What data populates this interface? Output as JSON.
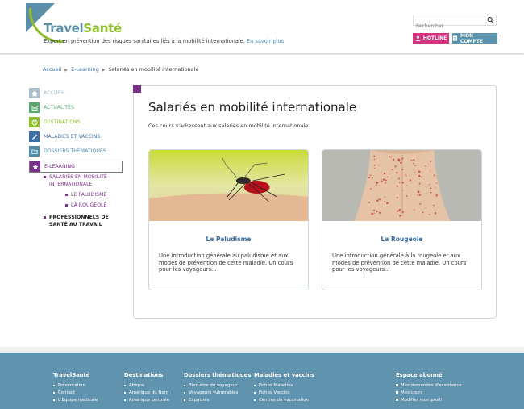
{
  "colors": {
    "brand_blue": "#5b8fa8",
    "brand_green": "#8fbf2c",
    "hotline": "#d3337f",
    "account": "#5a93ad",
    "purple": "#7a2f8a",
    "footer_bg": "#5f93ae"
  },
  "header": {
    "brand_part1": "Travel",
    "brand_part2": "Santé",
    "tagline": "Expert en prévention des risques sanitaires liés à la mobilité internationale.",
    "tagline_link": "En savoir plus",
    "search_placeholder": "Rechercher",
    "hotline_label": "HOTLINE",
    "account_label": "MON COMPTE"
  },
  "breadcrumb": {
    "home": "Accueil",
    "section": "E-Learning",
    "current": "Salariés en mobilité internationale"
  },
  "sidebar": {
    "items": [
      {
        "label": "Accueil",
        "icon": "home-icon",
        "color": "#a9bfcc"
      },
      {
        "label": "Actualités",
        "icon": "news-icon",
        "color": "#5aa870"
      },
      {
        "label": "Destinations",
        "icon": "globe-icon",
        "color": "#8fbf2c"
      },
      {
        "label": "Maladies et vaccins",
        "icon": "syringe-icon",
        "color": "#3b6ea5"
      },
      {
        "label": "Dossiers thématiques",
        "icon": "folder-icon",
        "color": "#4f8aa8"
      },
      {
        "label": "E-Learning",
        "icon": "graduation-cap-icon",
        "color": "#7a2f8a"
      }
    ],
    "sub": {
      "group1": "Salariés en mobilité internationale",
      "child1": "Le paludisme",
      "child2": "La rougeole",
      "group2": "Professionnels de santé au travail"
    }
  },
  "content": {
    "title": "Salariés en mobilité internationale",
    "intro": "Ces cours s'adressent aux salariés en mobilité internationale.",
    "courses": [
      {
        "title": "Le Paludisme",
        "description": "Une introduction générale au paludisme et aux modes de prévention de cette maladie. Un cours pour les voyageurs..."
      },
      {
        "title": "La Rougeole",
        "description": "Une introduction générale à la rougeole et aux modes de prévention de cette maladie. Un cours pour les voyageurs..."
      }
    ]
  },
  "footer": {
    "col1": {
      "heading": "TravelSanté",
      "links": [
        "Présentation",
        "Contact",
        "L'Equipe médicale"
      ]
    },
    "col2": {
      "heading": "Destinations",
      "links": [
        "Afrique",
        "Amérique du Nord",
        "Amérique centrale"
      ]
    },
    "col3": {
      "heading": "Dossiers thématiques",
      "links": [
        "Bien-être du voyageur",
        "Voyageurs vulnérables",
        "Expatriés"
      ]
    },
    "col4": {
      "heading": "Maladies et vaccins",
      "links": [
        "Fiches Maladies",
        "Fiches Vaccins",
        "Centres de vaccination"
      ]
    },
    "col5": {
      "heading": "Espace abonné",
      "links": [
        "Mes demandes d'assistance",
        "Mes cours",
        "Modifier mon profil"
      ]
    }
  }
}
